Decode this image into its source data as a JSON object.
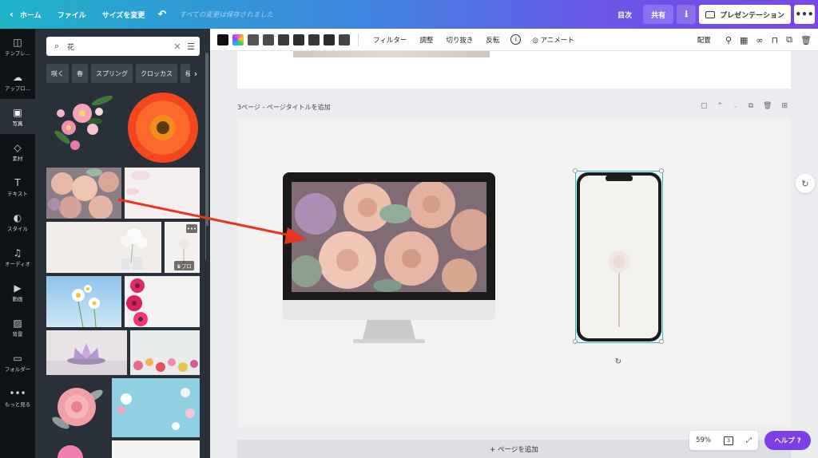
{
  "topbar": {
    "home": "ホーム",
    "file": "ファイル",
    "resize": "サイズを変更",
    "saved_status": "すべての変更は保存されました",
    "toc": "目次",
    "share": "共有",
    "present": "プレゼンテーション"
  },
  "rail": {
    "items": [
      {
        "label": "テンプレ..."
      },
      {
        "label": "アップロ..."
      },
      {
        "label": "写真"
      },
      {
        "label": "素材"
      },
      {
        "label": "テキスト"
      },
      {
        "label": "スタイル"
      },
      {
        "label": "オーディオ"
      },
      {
        "label": "動画"
      },
      {
        "label": "背景"
      },
      {
        "label": "フォルダー"
      },
      {
        "label": "もっと見る"
      }
    ]
  },
  "panel": {
    "search_value": "花",
    "chips": [
      "咲く",
      "春",
      "スプリング",
      "クロッカス",
      "桜"
    ],
    "pro_label": "プロ"
  },
  "edit_toolbar": {
    "filter": "フィルター",
    "adjust": "調整",
    "crop": "切り抜き",
    "flip": "反転",
    "animate": "アニメート",
    "position": "配置",
    "swatches": [
      "#111111",
      "#ff4bc8",
      "#555555",
      "#4a4a4a",
      "#3a3a3a",
      "#2e2e2e",
      "#383838",
      "#2a2a2a",
      "#444444"
    ]
  },
  "canvas": {
    "page_title": "3ページ - ページタイトルを追加",
    "add_page": "+ ページを追加",
    "zoom": "59%",
    "page_count": "3",
    "help": "ヘルプ ?"
  },
  "colors": {
    "accent": "#7d3ee8",
    "selection": "#16c0d1",
    "arrow": "#e8351f"
  }
}
